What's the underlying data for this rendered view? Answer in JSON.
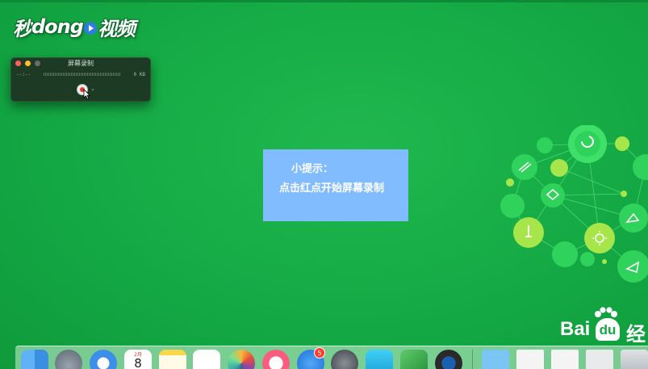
{
  "watermark": {
    "pre": "秒",
    "mid": "dong",
    "post": "视频"
  },
  "recorder": {
    "title": "屏幕录制",
    "time": "--:--",
    "size": "0 KB",
    "chevron": "⌄"
  },
  "tip": {
    "title": "小提示：",
    "body": "点击红点开始屏幕录制"
  },
  "baidu": {
    "text": "Bai",
    "tail": "du",
    "suffix": "经"
  },
  "dock": {
    "calendar_month": "2月",
    "calendar_day": "8",
    "appstore_badge": "5",
    "icons": [
      "finder-icon",
      "launchpad-icon",
      "safari-icon",
      "calendar-icon",
      "notes-icon",
      "reminders-icon",
      "photos-icon",
      "itunes-icon",
      "app-store-icon",
      "system-preferences-icon",
      "facetime-icon",
      "app-icon",
      "quicktime-icon",
      "folder-icon",
      "document-icon",
      "document-icon",
      "window-icon",
      "trash-icon"
    ]
  },
  "colors": {
    "background": "#14a944",
    "tip_background": "#80bcff",
    "record_red": "#e23b2e"
  }
}
